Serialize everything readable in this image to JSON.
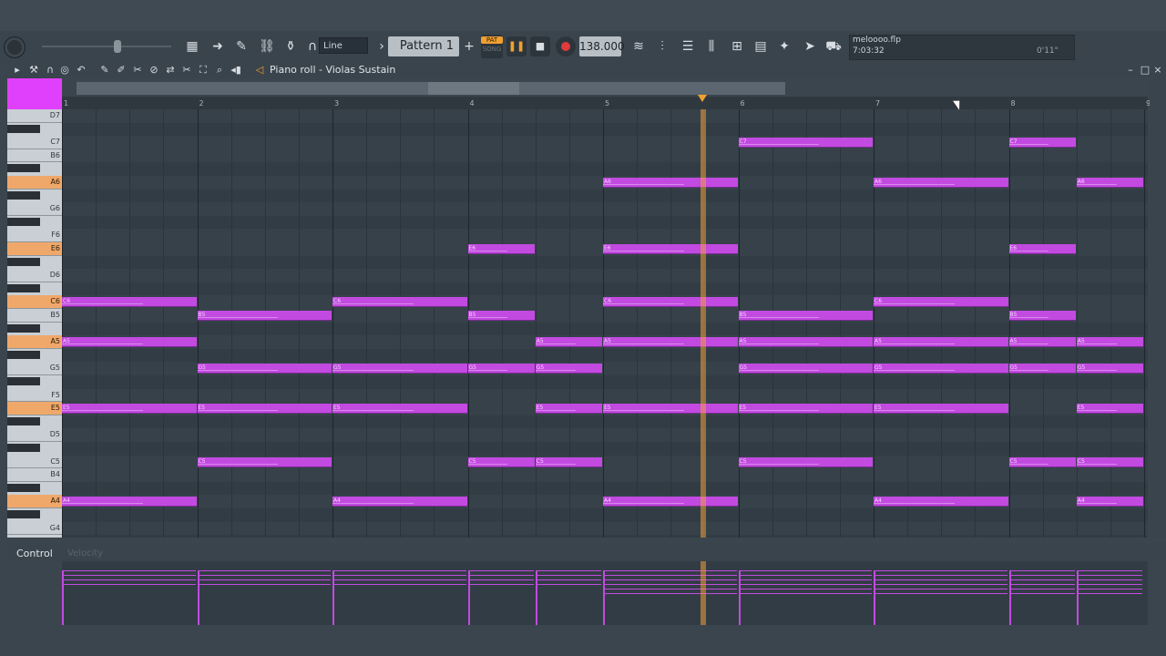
{
  "toolbar": {
    "snap_mode": "Line",
    "pattern": "Pattern 1",
    "pat_label": "PAT",
    "song_label": "SONG",
    "tempo": "138.000",
    "icons": [
      "piano-roll-icon",
      "arrow-icon",
      "brush-icon",
      "link-icon",
      "stamp-icon",
      "mixer-icon",
      "playlist-icon",
      "channel-rack-icon",
      "browser-icon",
      "plugin-icon",
      "cart-icon"
    ]
  },
  "hint": {
    "file_name": "meloooo.flp",
    "file_time": "7:03:32",
    "play_position": "0'11\""
  },
  "piano_roll": {
    "title": "Piano roll - Violas Sustain",
    "bars": [
      "1",
      "2",
      "3",
      "4",
      "5",
      "6",
      "7",
      "8",
      "9"
    ],
    "keys": [
      "D7",
      "C7",
      "B6",
      "A6",
      "G6",
      "F6",
      "E6",
      "D6",
      "C6",
      "B5",
      "A5",
      "G5",
      "F5",
      "E5",
      "D5",
      "C5",
      "B4",
      "A4",
      "G4"
    ],
    "highlighted_keys": [
      "A6",
      "E6",
      "C6",
      "A5",
      "E5",
      "A4"
    ],
    "notes": [
      {
        "pitch": "C7",
        "start": 5,
        "len": 1
      },
      {
        "pitch": "C7",
        "start": 7,
        "len": 0.5
      },
      {
        "pitch": "A6",
        "start": 4,
        "len": 1
      },
      {
        "pitch": "A6",
        "start": 6,
        "len": 1
      },
      {
        "pitch": "A6",
        "start": 7.5,
        "len": 0.5
      },
      {
        "pitch": "E6",
        "start": 3,
        "len": 0.5
      },
      {
        "pitch": "E6",
        "start": 4,
        "len": 1
      },
      {
        "pitch": "E6",
        "start": 7,
        "len": 0.5
      },
      {
        "pitch": "C6",
        "start": 0,
        "len": 1
      },
      {
        "pitch": "C6",
        "start": 2,
        "len": 1
      },
      {
        "pitch": "C6",
        "start": 4,
        "len": 1
      },
      {
        "pitch": "C6",
        "start": 6,
        "len": 1
      },
      {
        "pitch": "B5",
        "start": 1,
        "len": 1
      },
      {
        "pitch": "B5",
        "start": 3,
        "len": 0.5
      },
      {
        "pitch": "B5",
        "start": 5,
        "len": 1
      },
      {
        "pitch": "B5",
        "start": 7,
        "len": 0.5
      },
      {
        "pitch": "A5",
        "start": 0,
        "len": 1
      },
      {
        "pitch": "A5",
        "start": 3.5,
        "len": 0.5
      },
      {
        "pitch": "A5",
        "start": 4,
        "len": 1
      },
      {
        "pitch": "A5",
        "start": 5,
        "len": 1
      },
      {
        "pitch": "A5",
        "start": 6,
        "len": 1
      },
      {
        "pitch": "A5",
        "start": 7,
        "len": 0.5
      },
      {
        "pitch": "A5",
        "start": 7.5,
        "len": 0.5
      },
      {
        "pitch": "G5",
        "start": 1,
        "len": 1
      },
      {
        "pitch": "G5",
        "start": 2,
        "len": 1
      },
      {
        "pitch": "G5",
        "start": 3,
        "len": 0.5
      },
      {
        "pitch": "G5",
        "start": 3.5,
        "len": 0.5
      },
      {
        "pitch": "G5",
        "start": 5,
        "len": 1
      },
      {
        "pitch": "G5",
        "start": 6,
        "len": 1
      },
      {
        "pitch": "G5",
        "start": 7,
        "len": 0.5
      },
      {
        "pitch": "G5",
        "start": 7.5,
        "len": 0.5
      },
      {
        "pitch": "E5",
        "start": 0,
        "len": 1
      },
      {
        "pitch": "E5",
        "start": 1,
        "len": 1
      },
      {
        "pitch": "E5",
        "start": 2,
        "len": 1
      },
      {
        "pitch": "E5",
        "start": 3.5,
        "len": 0.5
      },
      {
        "pitch": "E5",
        "start": 4,
        "len": 1
      },
      {
        "pitch": "E5",
        "start": 5,
        "len": 1
      },
      {
        "pitch": "E5",
        "start": 6,
        "len": 1
      },
      {
        "pitch": "E5",
        "start": 7.5,
        "len": 0.5
      },
      {
        "pitch": "C5",
        "start": 1,
        "len": 1
      },
      {
        "pitch": "C5",
        "start": 3,
        "len": 0.5
      },
      {
        "pitch": "C5",
        "start": 3.5,
        "len": 0.5
      },
      {
        "pitch": "C5",
        "start": 5,
        "len": 1
      },
      {
        "pitch": "C5",
        "start": 7,
        "len": 0.5
      },
      {
        "pitch": "C5",
        "start": 7.5,
        "len": 0.5
      },
      {
        "pitch": "A4",
        "start": 0,
        "len": 1
      },
      {
        "pitch": "A4",
        "start": 2,
        "len": 1
      },
      {
        "pitch": "A4",
        "start": 4,
        "len": 1
      },
      {
        "pitch": "A4",
        "start": 6,
        "len": 1
      },
      {
        "pitch": "A4",
        "start": 7.5,
        "len": 0.5
      }
    ],
    "playhead_bar": 4.72
  },
  "control": {
    "label": "Control",
    "target": "Velocity"
  },
  "colors": {
    "note": "#c24ae0",
    "accent": "#f0a030",
    "grid_bg": "#36414a"
  }
}
